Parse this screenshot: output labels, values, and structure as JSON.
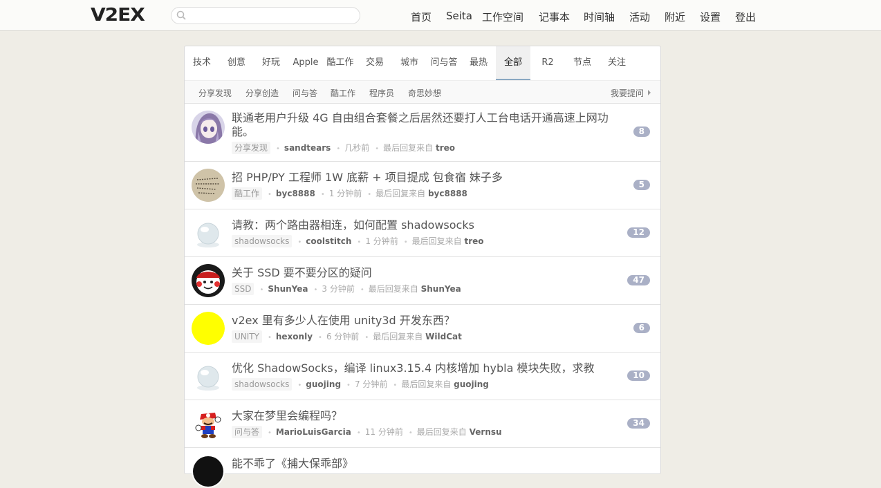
{
  "header": {
    "logo": "V2EX",
    "search": {
      "value": "",
      "placeholder": ""
    },
    "nav": [
      "首页",
      "Seita",
      "工作空间",
      "记事本",
      "时间轴",
      "活动",
      "附近",
      "设置",
      "登出"
    ]
  },
  "tabs": [
    "技术",
    "创意",
    "好玩",
    "Apple",
    "酷工作",
    "交易",
    "城市",
    "问与答",
    "最热",
    "全部",
    "R2",
    "节点",
    "关注"
  ],
  "active_tab": "全部",
  "subtabs": [
    "分享发现",
    "分享创造",
    "问与答",
    "酷工作",
    "程序员",
    "奇思妙想"
  ],
  "ask_label": "我要提问",
  "meta_labels": {
    "last_reply": "最后回复来自"
  },
  "topics": [
    {
      "title": "联通老用户升级 4G 自由组合套餐之后居然还要打人工台电话开通高速上网功能。",
      "node": "分享发现",
      "author": "sandtears",
      "time": "几秒前",
      "last_reply_by": "treo",
      "replies": "8",
      "avatar_icon": "anime-girl-avatar"
    },
    {
      "title": "招 PHP/PY 工程师 1W 底薪 + 项目提成 包食宿 妹子多",
      "node": "酷工作",
      "author": "byc8888",
      "time": "1 分钟前",
      "last_reply_by": "byc8888",
      "replies": "5",
      "avatar_icon": "handwriting-avatar"
    },
    {
      "title": "请教：两个路由器相连，如何配置 shadowsocks",
      "node": "shadowsocks",
      "author": "coolstitch",
      "time": "1 分钟前",
      "last_reply_by": "treo",
      "replies": "12",
      "avatar_icon": "default-sphere-avatar"
    },
    {
      "title": "关于 SSD 要不要分区的疑问",
      "node": "SSD",
      "author": "ShunYea",
      "time": "3 分钟前",
      "last_reply_by": "ShunYea",
      "replies": "47",
      "avatar_icon": "red-face-avatar"
    },
    {
      "title": "v2ex 里有多少人在使用 unity3d 开发东西？",
      "node": "UNITY",
      "author": "hexonly",
      "time": "6 分钟前",
      "last_reply_by": "WildCat",
      "replies": "6",
      "avatar_icon": "yellow-circle-avatar"
    },
    {
      "title": "优化 ShadowSocks，编译 linux3.15.4 内核增加 hybla 模块失败，求教",
      "node": "shadowsocks",
      "author": "guojing",
      "time": "7 分钟前",
      "last_reply_by": "guojing",
      "replies": "10",
      "avatar_icon": "default-sphere-avatar"
    },
    {
      "title": "大家在梦里会编程吗？",
      "node": "问与答",
      "author": "MarioLuisGarcia",
      "time": "11 分钟前",
      "last_reply_by": "Vernsu",
      "replies": "34",
      "avatar_icon": "mario-avatar"
    }
  ],
  "partial_topic_title": "能不乖了《捕大保乖部》",
  "colors": {
    "count_badge": "#aab0c6",
    "active_tab_underline": "#8aa8c2",
    "background": "#efede6"
  }
}
